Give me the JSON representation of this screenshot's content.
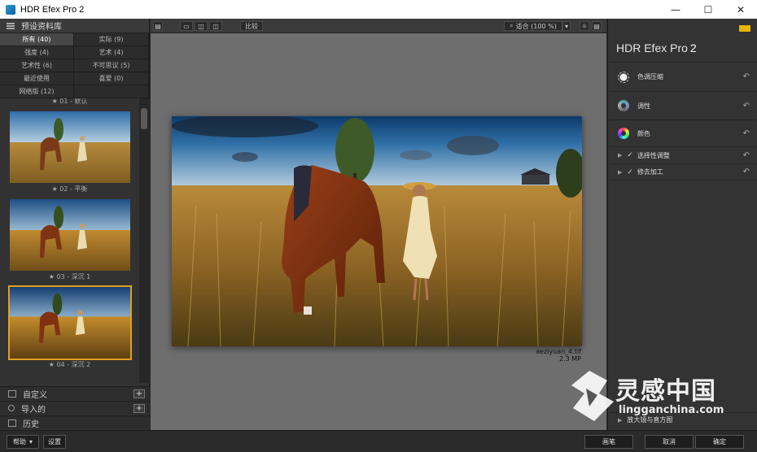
{
  "window": {
    "title": "HDR Efex Pro 2",
    "minimize": "—",
    "maximize": "☐",
    "close": "✕"
  },
  "left_panel": {
    "header": "预设资料库",
    "categories": [
      {
        "label": "所有 (40)",
        "active": true
      },
      {
        "label": "实际 (9)",
        "active": false
      },
      {
        "label": "强度 (4)",
        "active": false
      },
      {
        "label": "艺术 (4)",
        "active": false
      },
      {
        "label": "艺术性 (6)",
        "active": false
      },
      {
        "label": "不可思议 (5)",
        "active": false
      },
      {
        "label": "最近使用",
        "active": false
      },
      {
        "label": "喜爱 (0)",
        "active": false
      },
      {
        "label": "网络版 (12)",
        "active": false
      },
      {
        "label": "",
        "active": false
      }
    ],
    "presets": [
      {
        "label": "★ 01 - 默认"
      },
      {
        "label": "★ 02 - 平衡"
      },
      {
        "label": "★ 03 - 深沉 1"
      },
      {
        "label": "★ 04 - 深沉 2"
      }
    ],
    "sections": {
      "custom": "自定义",
      "imported": "导入的",
      "history": "历史",
      "plus": "+"
    }
  },
  "toolbar": {
    "compare": "比较",
    "zoom": "适合 (100 %)",
    "zoom_caret": "▾"
  },
  "image": {
    "filename": "aeziyuan_4.tif",
    "size": "2.3 MP"
  },
  "right_panel": {
    "title": "HDR Efex Pro",
    "title_num": "2",
    "items": [
      {
        "label": "色调压缩",
        "icon": "sun-icon"
      },
      {
        "label": "调性",
        "icon": "tonality-wheel-icon"
      },
      {
        "label": "颜色",
        "icon": "color-wheel-icon"
      },
      {
        "label": "选择性调整",
        "icon": "expand-triangle-icon",
        "checked": true
      },
      {
        "label": "修去加工",
        "icon": "expand-triangle-icon",
        "checked": true
      }
    ],
    "loupe": "放大镜与直方图",
    "reset_symbol": "↶"
  },
  "bottom_bar": {
    "help": "帮助",
    "help_caret": "▾",
    "settings": "设置",
    "brush": "画笔",
    "cancel": "取消",
    "ok": "确定"
  },
  "watermark": {
    "cn": "灵感中国",
    "url": "lingganchina.com"
  },
  "colors": {
    "selection_border": "#e0a020",
    "canvas_bg": "#6e6e6e",
    "panel_bg": "#333333"
  }
}
